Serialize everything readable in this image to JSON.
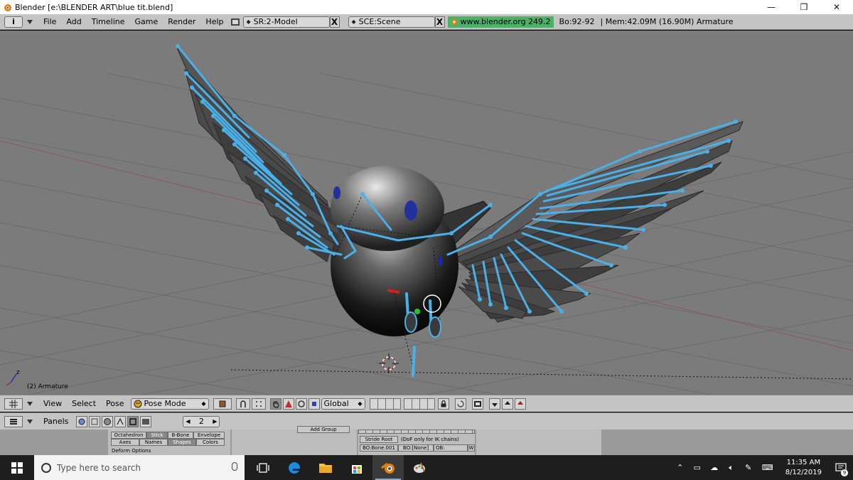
{
  "window": {
    "title": "Blender [e:\\BLENDER ART\\blue tit.blend]",
    "minimize": "—",
    "restore": "❐",
    "close": "✕"
  },
  "topheader": {
    "editor_icon": "i",
    "menus": [
      "File",
      "Add",
      "Timeline",
      "Game",
      "Render",
      "Help"
    ],
    "screen_field": "SR:2-Model",
    "scene_field": "SCE:Scene",
    "close_x": "X",
    "website": "www.blender.org 249.2",
    "bones": "Bo:92-92",
    "memory": "| Mem:42.09M (16.90M) Armature"
  },
  "viewport": {
    "label": "(2) Armature",
    "axis_label": "z"
  },
  "viewheader": {
    "menus": [
      "View",
      "Select",
      "Pose"
    ],
    "mode": "Pose Mode",
    "orientation": "Global"
  },
  "btnheader": {
    "label": "Panels",
    "page": "2"
  },
  "buttons": {
    "octahedron": "Octahedron",
    "stick": "Stick",
    "bbone": "B-Bone",
    "envelope": "Envelope",
    "axes": "Axes",
    "names": "Names",
    "shapes": "Shapes",
    "colors": "Colors",
    "deform_options": "Deform Options",
    "add_group": "Add Group",
    "stride_root": "Stride Root",
    "ik_note": "(DoF only for IK chains)",
    "bone_name": "BO:Bone.001",
    "bone_parent": "BO:[None]",
    "ob": "OB:",
    "w": "W"
  },
  "taskbar": {
    "search_placeholder": "Type here to search",
    "time": "11:35 AM",
    "date": "8/12/2019",
    "notif_count": "9"
  },
  "colors": {
    "viewport_bg": "#7b7b7b",
    "bone_blue": "#4bb0e8",
    "header_gray": "#c4c4c4"
  }
}
